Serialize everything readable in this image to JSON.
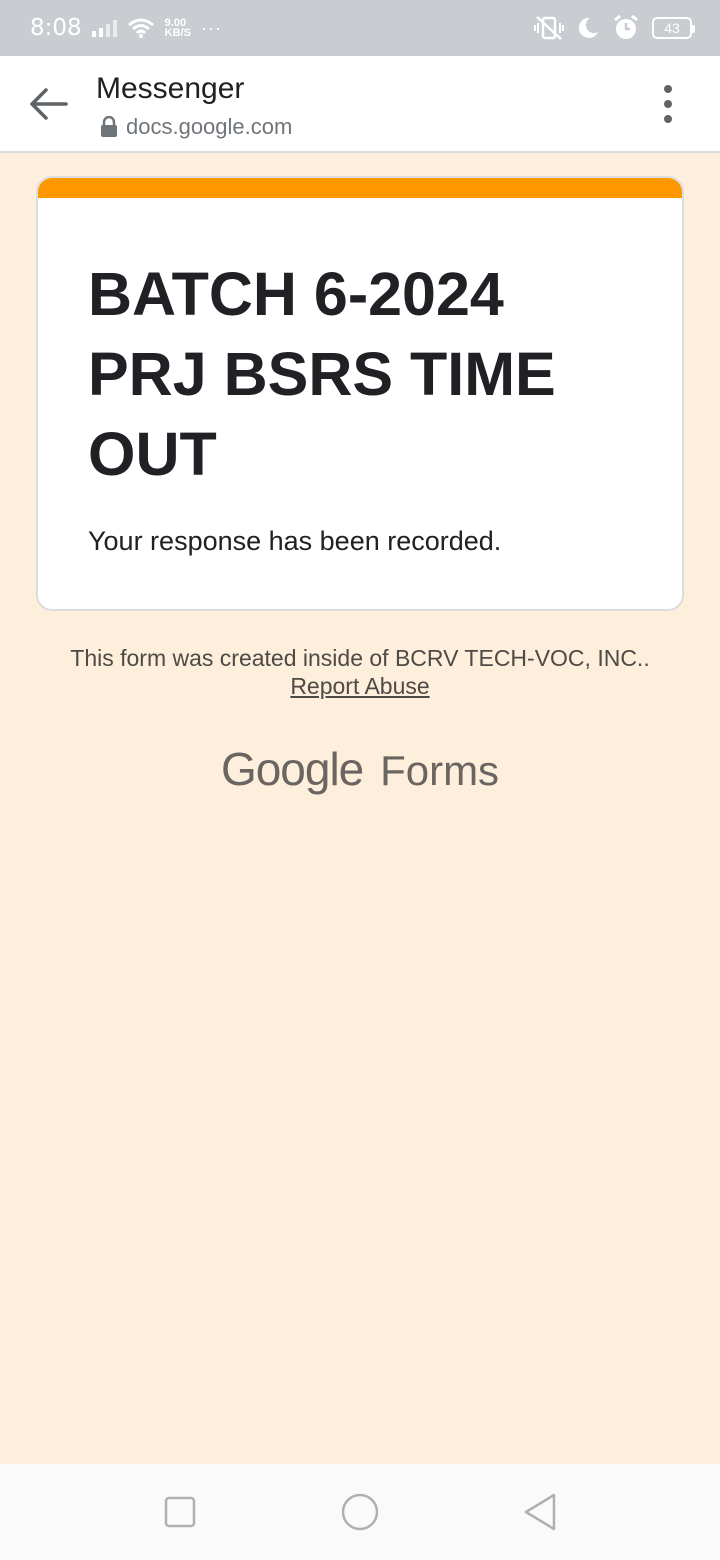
{
  "status_bar": {
    "time": "8:08",
    "speed_value": "9.00",
    "speed_unit": "KB/S",
    "more_indicator": "···",
    "battery_level": "43"
  },
  "app_bar": {
    "title": "Messenger",
    "url": "docs.google.com"
  },
  "form": {
    "accent_color": "#ff9800",
    "title": "BATCH 6-2024 PRJ BSRS TIME OUT",
    "confirmation": "Your response has been recorded."
  },
  "footer": {
    "note": "This form was created inside of BCRV TECH-VOC, INC..",
    "report_link": "Report Abuse",
    "brand_google": "Google",
    "brand_forms": "Forms"
  },
  "icons": {
    "back": "arrow-left-icon",
    "lock": "lock-icon",
    "more": "more-vertical-icon",
    "wifi": "wifi-icon",
    "signal": "signal-icon",
    "mute": "vibrate-off-icon",
    "dnd": "moon-icon",
    "alarm": "alarm-icon",
    "nav_recents": "square-icon",
    "nav_home": "circle-icon",
    "nav_back": "triangle-back-icon"
  }
}
